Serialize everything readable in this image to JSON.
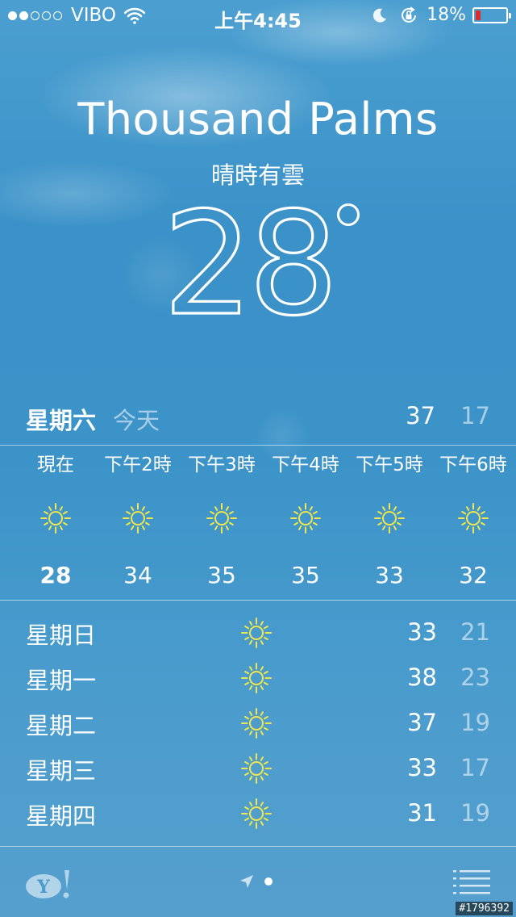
{
  "status_bar": {
    "signal_dots_filled": 2,
    "signal_dots_total": 5,
    "carrier": "VIBO",
    "time": "上午4:45",
    "battery_percent": "18%",
    "battery_level": 0.18,
    "battery_color": "#e02a2a",
    "icons": [
      "wifi-icon",
      "moon-icon",
      "lock-rotation-icon",
      "battery-icon"
    ]
  },
  "header": {
    "city": "Thousand Palms",
    "condition": "晴時有雲",
    "temperature": "28",
    "degree_symbol": "°"
  },
  "today": {
    "day": "星期六",
    "label": "今天",
    "high": "37",
    "low": "17"
  },
  "hourly": [
    {
      "label": "現在",
      "icon": "sun-icon",
      "temp": "28"
    },
    {
      "label": "下午2時",
      "icon": "sun-icon",
      "temp": "34"
    },
    {
      "label": "下午3時",
      "icon": "sun-icon",
      "temp": "35"
    },
    {
      "label": "下午4時",
      "icon": "sun-icon",
      "temp": "35"
    },
    {
      "label": "下午5時",
      "icon": "sun-icon",
      "temp": "33"
    },
    {
      "label": "下午6時",
      "icon": "sun-icon",
      "temp": "32"
    }
  ],
  "daily": [
    {
      "day": "星期日",
      "icon": "sun-icon",
      "high": "33",
      "low": "21"
    },
    {
      "day": "星期一",
      "icon": "sun-icon",
      "high": "38",
      "low": "23"
    },
    {
      "day": "星期二",
      "icon": "sun-icon",
      "high": "37",
      "low": "19"
    },
    {
      "day": "星期三",
      "icon": "sun-icon",
      "high": "33",
      "low": "17"
    },
    {
      "day": "星期四",
      "icon": "sun-icon",
      "high": "31",
      "low": "19"
    }
  ],
  "bottom_bar": {
    "icons": [
      "yahoo-icon",
      "location-arrow-icon",
      "list-icon"
    ],
    "current_page": 1,
    "page_count": 1
  },
  "watermark": "#1796392",
  "colors": {
    "sun": "#f2e64a",
    "sky_top": "#4b9fd0",
    "sky_bottom": "#559fcd",
    "muted_text": "rgba(255,255,255,0.55)"
  }
}
